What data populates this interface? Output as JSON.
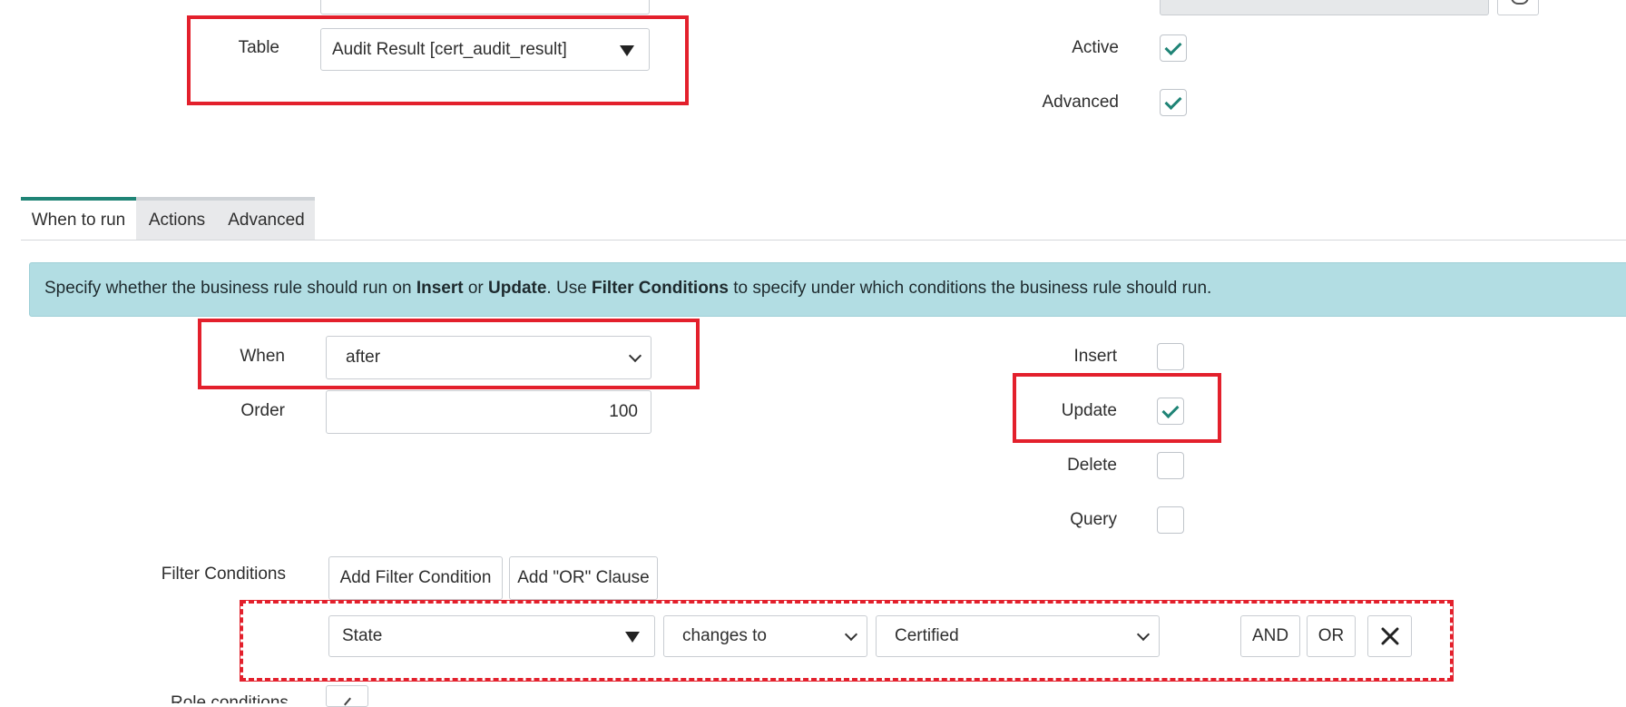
{
  "colors": {
    "accent": "#1f8476",
    "highlight": "#e3202c",
    "info_bg": "#b2dde3"
  },
  "top": {
    "table_label": "Table",
    "table_value": "Audit Result [cert_audit_result]",
    "active_label": "Active",
    "active_checked": true,
    "advanced_label": "Advanced",
    "advanced_checked": true
  },
  "tabs": [
    {
      "label": "When to run",
      "active": true
    },
    {
      "label": "Actions",
      "active": false
    },
    {
      "label": "Advanced",
      "active": false
    }
  ],
  "info": {
    "t1": "Specify whether the business rule should run on ",
    "b1": "Insert",
    "t2": " or ",
    "b2": "Update",
    "t3": ". Use ",
    "b3": "Filter Conditions",
    "t4": " to specify under which conditions the business rule should run."
  },
  "when_section": {
    "when_label": "When",
    "when_value": "after",
    "order_label": "Order",
    "order_value": "100",
    "insert_label": "Insert",
    "insert_checked": false,
    "update_label": "Update",
    "update_checked": true,
    "delete_label": "Delete",
    "delete_checked": false,
    "query_label": "Query",
    "query_checked": false
  },
  "filter": {
    "label": "Filter Conditions",
    "add_condition": "Add Filter Condition",
    "add_or": "Add \"OR\" Clause",
    "field": "State",
    "operator": "changes to",
    "value": "Certified",
    "and_label": "AND",
    "or_label": "OR"
  },
  "role_label": "Role conditions",
  "icons": [
    "dropdown-triangle-icon",
    "chevron-down-icon",
    "check-icon",
    "close-icon",
    "lock-icon",
    "pencil-icon"
  ]
}
